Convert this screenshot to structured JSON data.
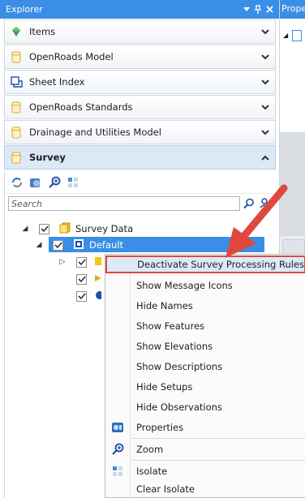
{
  "explorer": {
    "title": "Explorer",
    "controls": [
      "▾",
      "ᵖ",
      "✕"
    ]
  },
  "sections": [
    {
      "label": "Items",
      "icon": "items-icon",
      "expanded": false
    },
    {
      "label": "OpenRoads Model",
      "icon": "database-icon",
      "expanded": false
    },
    {
      "label": "Sheet Index",
      "icon": "sheet-index-icon",
      "expanded": false
    },
    {
      "label": "OpenRoads Standards",
      "icon": "database-icon",
      "expanded": false
    },
    {
      "label": "Drainage and Utilities Model",
      "icon": "database-icon",
      "expanded": false
    },
    {
      "label": "Survey",
      "icon": "database-icon",
      "expanded": true
    }
  ],
  "survey": {
    "search_placeholder": "Search",
    "tree": {
      "root_label": "Survey Data",
      "child_label": "Default"
    }
  },
  "properties_panel": {
    "title": "Properties"
  },
  "context_menu": {
    "items": [
      {
        "label": "Deactivate Survey Processing Rules",
        "highlighted": true
      },
      {
        "label": "Show Message Icons"
      },
      {
        "label": "Hide Names"
      },
      {
        "label": "Show Features"
      },
      {
        "label": "Show Elevations"
      },
      {
        "label": "Show Descriptions"
      },
      {
        "label": "Hide Setups"
      },
      {
        "label": "Hide Observations"
      },
      {
        "label": "Properties",
        "icon": "properties-icon"
      },
      {
        "label": "Zoom",
        "icon": "zoom-icon"
      },
      {
        "label": "Isolate",
        "icon": "isolate-icon"
      },
      {
        "label": "Clear Isolate"
      }
    ]
  },
  "colors": {
    "accent": "#3a8ee6",
    "highlight_border": "#e0483e",
    "arrow": "#e0483e"
  }
}
